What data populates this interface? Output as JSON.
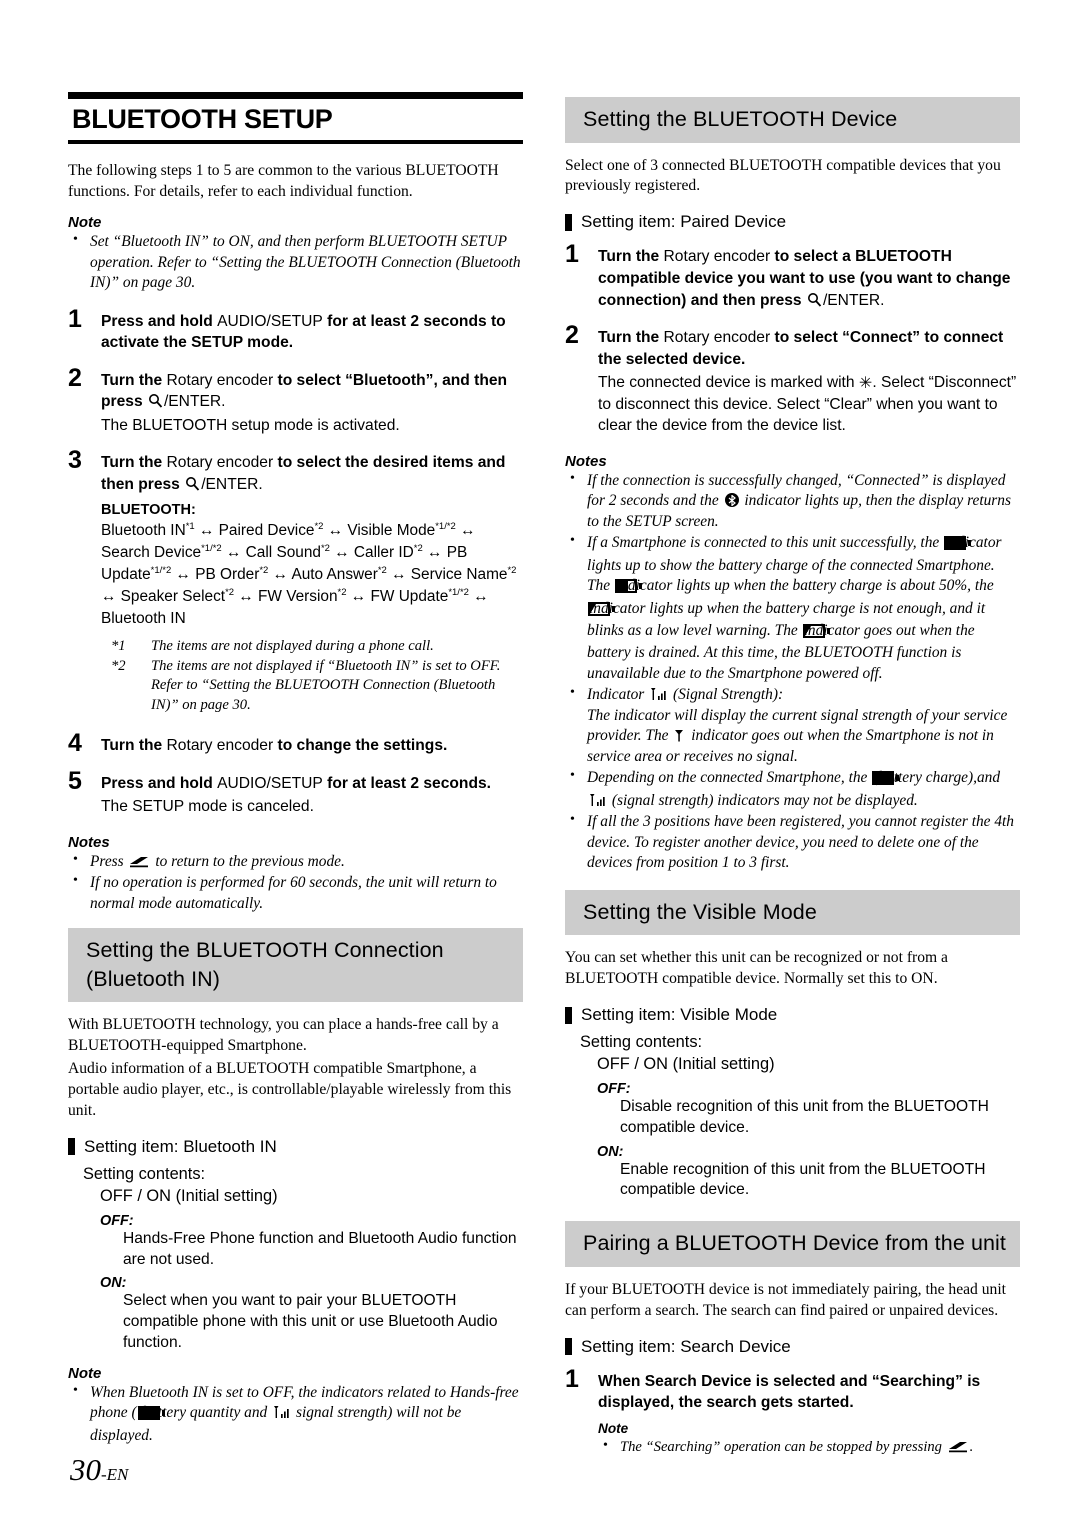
{
  "page": {
    "number_label": "30",
    "lang_suffix": "-EN",
    "accent_gray": "#cccccc",
    "text_color": "#000000"
  },
  "chapter": {
    "title": "BLUETOOTH SETUP",
    "intro": "The following steps 1 to 5 are common to the various BLUETOOTH functions. For details, refer to each individual function."
  },
  "left_column": {
    "note_heading": "Note",
    "note_items": [
      "Set “Bluetooth IN” to ON, and then perform BLUETOOTH SETUP operation. Refer to “Setting the BLUETOOTH Connection (Bluetooth IN)” on page 30."
    ],
    "steps": [
      {
        "num": "1",
        "main_a": "Press and hold ",
        "main_b": "AUDIO/SETUP",
        "main_c": " for at least 2 seconds to activate the SETUP mode.",
        "sub": ""
      },
      {
        "num": "2",
        "main_a": "Turn the ",
        "main_b": "Rotary encoder",
        "main_c": " to select “Bluetooth”, and then press ",
        "main_d": "/ENTER.",
        "sub": "The BLUETOOTH setup mode is activated."
      },
      {
        "num": "3",
        "main_a": "Turn the ",
        "main_b": "Rotary encoder",
        "main_c": " to select the desired items and then press ",
        "main_d": "/ENTER.",
        "sub": ""
      },
      {
        "num": "4",
        "main_a": "Turn the ",
        "main_b": "Rotary encoder",
        "main_c": " to change the settings.",
        "sub": ""
      },
      {
        "num": "5",
        "main_a": "Press and hold ",
        "main_b": "AUDIO/SETUP",
        "main_c": " for at least 2 seconds.",
        "sub": "The SETUP mode is canceled."
      }
    ],
    "chain": {
      "title": "BLUETOOTH:",
      "items": [
        {
          "label": "Bluetooth IN",
          "sup": "*1"
        },
        {
          "label": "Paired Device",
          "sup": "*2"
        },
        {
          "label": "Visible Mode",
          "sup": "*1/*2"
        },
        {
          "label": "Search Device",
          "sup": "*1/*2"
        },
        {
          "label": "Call Sound",
          "sup": "*2"
        },
        {
          "label": "Caller ID",
          "sup": "*2"
        },
        {
          "label": "PB Update",
          "sup": "*1/*2"
        },
        {
          "label": "PB Order",
          "sup": "*2"
        },
        {
          "label": "Auto Answer",
          "sup": "*2"
        },
        {
          "label": "Service Name",
          "sup": "*2"
        },
        {
          "label": "Speaker Select",
          "sup": "*2"
        },
        {
          "label": "FW Version",
          "sup": "*2"
        },
        {
          "label": "FW Update",
          "sup": "*1/*2"
        },
        {
          "label": "Bluetooth IN",
          "sup": ""
        }
      ],
      "separator": "↔",
      "footnotes": [
        {
          "mark": "*1",
          "text": "The items are not displayed during a phone call."
        },
        {
          "mark": "*2",
          "text": "The items are not displayed if “Bluetooth IN” is set to OFF. Refer to “Setting the BLUETOOTH Connection (Bluetooth IN)” on page 30."
        }
      ]
    },
    "notes_heading": "Notes",
    "notes_items": [
      {
        "pre": "Press ",
        "icon": "back-icon",
        "post": " to return to the previous mode."
      },
      {
        "pre": "If no operation is performed for 60 seconds, the unit will return to normal mode automatically.",
        "icon": "",
        "post": ""
      }
    ],
    "section_connection": {
      "heading": "Setting the BLUETOOTH Connection (Bluetooth IN)",
      "paragraphs": [
        "With BLUETOOTH technology, you can place a hands-free call by a BLUETOOTH-equipped Smartphone.",
        "Audio information of a BLUETOOTH compatible Smartphone, a portable audio player, etc., is controllable/playable wirelessly from this unit."
      ],
      "setting_item": "Setting item: Bluetooth IN",
      "setting_contents_label": "Setting contents:",
      "setting_values": "OFF / ON (Initial setting)",
      "options": [
        {
          "label": "OFF:",
          "desc": "Hands-Free Phone function and Bluetooth Audio function are not used."
        },
        {
          "label": "ON:",
          "desc": "Select when you want to pair your BLUETOOTH compatible phone with this unit or use Bluetooth Audio function."
        }
      ],
      "note_heading": "Note",
      "note_text_a": "When Bluetooth IN is set to OFF, the indicators related to Hands-free phone (",
      "note_text_b": " battery quantity and ",
      "note_text_c": " signal strength) will not be displayed."
    }
  },
  "right_column": {
    "section_device": {
      "heading": "Setting the BLUETOOTH Device",
      "intro": "Select one of 3 connected BLUETOOTH compatible devices that you previously registered.",
      "setting_item": "Setting item: Paired Device",
      "steps": [
        {
          "num": "1",
          "main_a": "Turn the ",
          "main_b": "Rotary encoder",
          "main_c": " to select a BLUETOOTH compatible device you want to use (you want to change connection) and then press ",
          "main_d": "/ENTER.",
          "sub": ""
        },
        {
          "num": "2",
          "main_a": "Turn the ",
          "main_b": "Rotary encoder",
          "main_c": " to select “Connect” to connect the selected device.",
          "sub_a": "The connected device is marked with ",
          "sub_b": ". Select “Disconnect” to disconnect this device. Select “Clear” when you want to clear the device from the device list."
        }
      ],
      "notes_heading": "Notes",
      "notes": [
        {
          "parts": [
            {
              "t": "If the connection is successfully changed, “Connected” is displayed for 2 seconds and the "
            },
            {
              "icon": "bluetooth-icon"
            },
            {
              "t": " indicator lights up, then the display returns to the SETUP screen."
            }
          ]
        },
        {
          "parts": [
            {
              "t": "If a Smartphone is connected to this unit successfully, the "
            },
            {
              "icon": "battery-full-icon"
            },
            {
              "t": " indicator lights up to show the battery charge of the connected Smartphone. The "
            },
            {
              "icon": "battery-half-icon"
            },
            {
              "t": " indicator lights up when the battery charge is about 50%, the "
            },
            {
              "icon": "battery-low-icon"
            },
            {
              "t": " indicator lights up when the battery charge is not enough, and it blinks as a low level warning. The "
            },
            {
              "icon": "battery-low-icon"
            },
            {
              "t": " indicator goes out when the battery is drained. At this time, the BLUETOOTH function is unavailable due to the Smartphone powered off."
            }
          ]
        },
        {
          "parts": [
            {
              "t": "Indicator "
            },
            {
              "icon": "signal-icon"
            },
            {
              "t": " (Signal Strength):"
            },
            {
              "br": true
            },
            {
              "t": "The indicator will display the current signal strength of your service provider. The "
            },
            {
              "icon": "antenna-icon"
            },
            {
              "t": " indicator goes out when the Smartphone is not in service area or receives no signal."
            }
          ]
        },
        {
          "parts": [
            {
              "t": "Depending on the connected Smartphone, the "
            },
            {
              "icon": "battery-full-icon"
            },
            {
              "t": " (battery charge),and "
            },
            {
              "icon": "signal-icon"
            },
            {
              "t": " (signal strength) indicators may not be displayed."
            }
          ]
        },
        {
          "parts": [
            {
              "t": "If all the 3 positions have been registered, you cannot register the 4th device. To register another device, you need to delete one of the devices from position 1 to 3 first."
            }
          ]
        }
      ]
    },
    "section_visible": {
      "heading": "Setting the Visible Mode",
      "intro": "You can set whether this unit can be recognized or not from a BLUETOOTH compatible device. Normally set this to ON.",
      "setting_item": "Setting item: Visible Mode",
      "setting_contents_label": "Setting contents:",
      "setting_values": "OFF / ON (Initial setting)",
      "options": [
        {
          "label": "OFF:",
          "desc": "Disable recognition of this unit from the BLUETOOTH compatible device."
        },
        {
          "label": "ON:",
          "desc": "Enable recognition of this unit from the BLUETOOTH compatible device."
        }
      ]
    },
    "section_pairing": {
      "heading": "Pairing a BLUETOOTH Device from the unit",
      "intro": "If your BLUETOOTH device is not immediately pairing, the head unit can perform a search. The search can find paired or unpaired devices.",
      "setting_item": "Setting item: Search Device",
      "step": {
        "num": "1",
        "text": "When Search Device is selected and “Searching” is displayed, the search gets started."
      },
      "note_heading": "Note",
      "note_text_a": "The “Searching” operation can be stopped by pressing ",
      "note_text_b": "."
    }
  },
  "icons": {
    "magnifier": "magnifier-icon",
    "back": "back-icon",
    "star": "✳",
    "bluetooth": "bluetooth-icon"
  }
}
